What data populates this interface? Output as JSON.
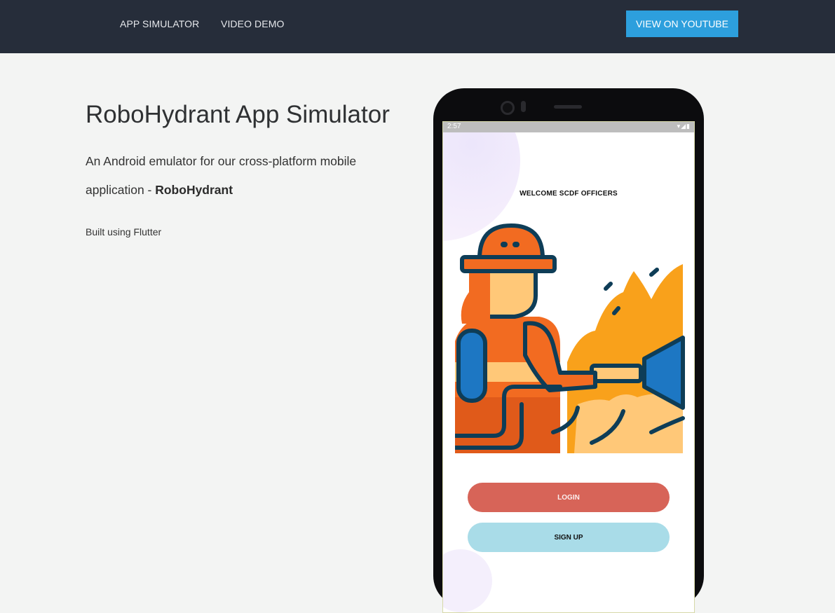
{
  "nav": {
    "links": [
      "APP SIMULATOR",
      "VIDEO DEMO"
    ],
    "cta": "VIEW ON YOUTUBE"
  },
  "hero": {
    "title": "RoboHydrant App Simulator",
    "description_prefix": "An Android emulator for our cross-platform mobile application - ",
    "description_bold": "RoboHydrant",
    "built_with": "Built using Flutter"
  },
  "phone": {
    "status_time": "2:57",
    "status_icons": "▾◢▮",
    "welcome": "WELCOME SCDF OFFICERS",
    "login_label": "LOGIN",
    "signup_label": "SIGN UP",
    "illustration": "firefighter-illustration"
  },
  "colors": {
    "navbar": "#262d3a",
    "cta": "#2d9fdd",
    "login": "#d76458",
    "signup": "#a9dce8"
  }
}
